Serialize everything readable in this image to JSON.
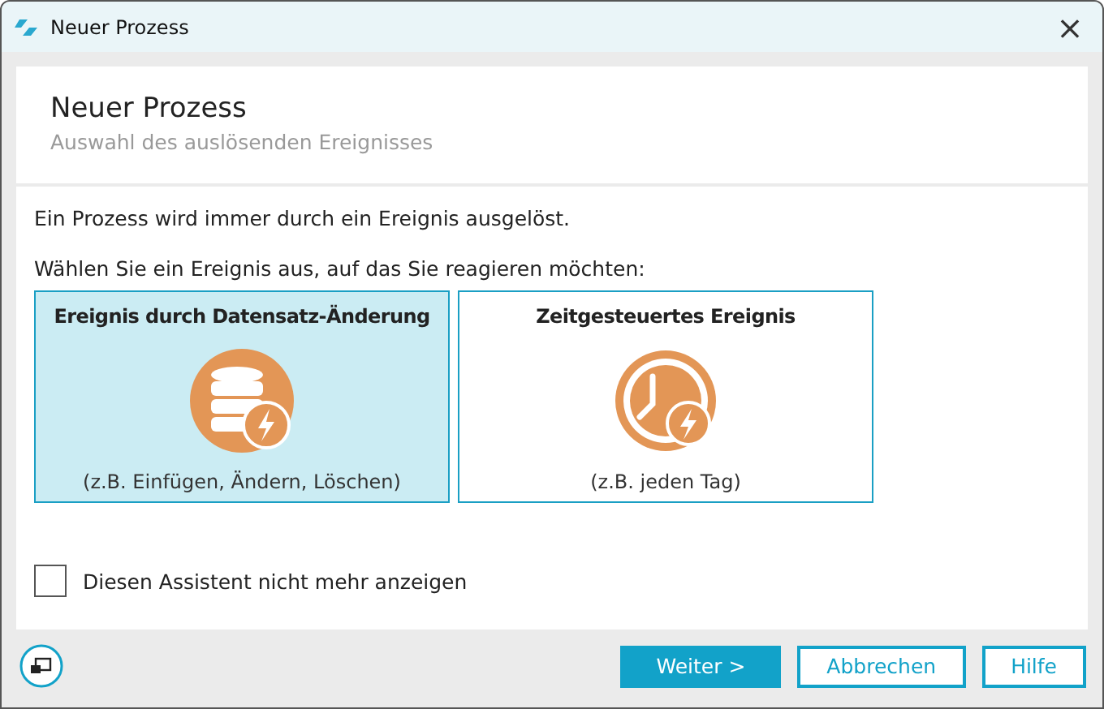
{
  "window": {
    "title": "Neuer Prozess",
    "close": "×"
  },
  "header": {
    "title": "Neuer Prozess",
    "subtitle": "Auswahl des auslösenden Ereignisses"
  },
  "intro": "Ein Prozess wird immer durch ein Ereignis ausgelöst.",
  "prompt": "Wählen Sie ein Ereignis aus, auf das Sie reagieren möchten:",
  "options": [
    {
      "kind": "database",
      "title": "Ereignis durch Datensatz-Änderung",
      "example": "(z.B. Einfügen, Ändern, Löschen)",
      "selected": true
    },
    {
      "kind": "clock",
      "title": "Zeitgesteuertes Ereignis",
      "example": "(z.B. jeden Tag)",
      "selected": false
    }
  ],
  "dont_show_again": {
    "label": "Diesen Assistent nicht mehr anzeigen",
    "checked": false
  },
  "buttons": [
    {
      "label": "Weiter >",
      "primary": true
    },
    {
      "label": "Abbrechen",
      "primary": false
    },
    {
      "label": "Hilfe",
      "primary": false
    }
  ]
}
